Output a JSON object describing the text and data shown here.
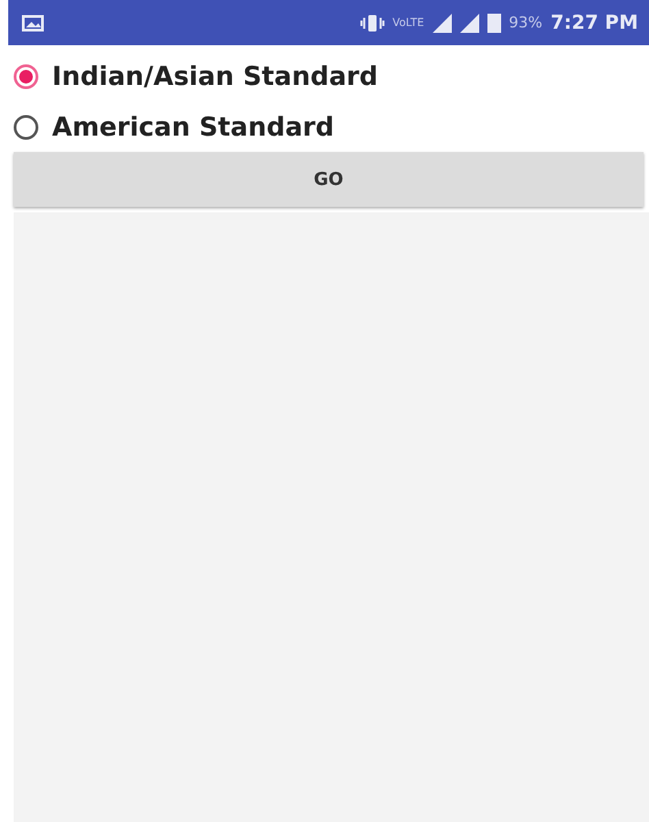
{
  "status_bar": {
    "network": "VoLTE",
    "battery": "93%",
    "time": "7:27 PM"
  },
  "options": [
    {
      "label": "Indian/Asian Standard",
      "selected": true
    },
    {
      "label": "American Standard",
      "selected": false
    }
  ],
  "button": "GO"
}
